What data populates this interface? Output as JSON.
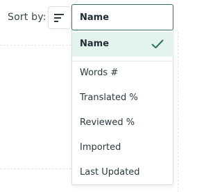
{
  "sort": {
    "label": "Sort by:",
    "order_icon": "sort-lines-icon",
    "selected_value": "Name"
  },
  "options": [
    {
      "label": "Name",
      "selected": true
    },
    {
      "label": "Words #",
      "selected": false
    },
    {
      "label": "Translated %",
      "selected": false
    },
    {
      "label": "Reviewed %",
      "selected": false
    },
    {
      "label": "Imported",
      "selected": false
    },
    {
      "label": "Last Updated",
      "selected": false
    }
  ],
  "colors": {
    "accent": "#2e6f66",
    "selected_bg": "#e3f3ee",
    "check": "#2e6f66"
  }
}
